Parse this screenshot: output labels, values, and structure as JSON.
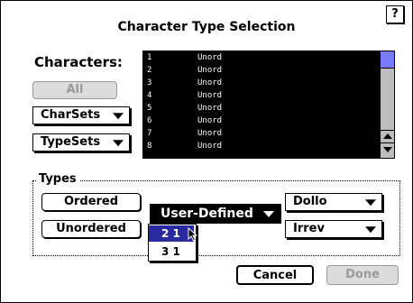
{
  "dialog": {
    "title": "Character Type Selection",
    "help_label": "?"
  },
  "characters": {
    "label": "Characters:",
    "all_button": "All",
    "charsets_popup": "CharSets",
    "typesets_popup": "TypeSets",
    "list": [
      {
        "num": "1",
        "value": "Unord"
      },
      {
        "num": "2",
        "value": "Unord"
      },
      {
        "num": "3",
        "value": "Unord"
      },
      {
        "num": "4",
        "value": "Unord"
      },
      {
        "num": "5",
        "value": "Unord"
      },
      {
        "num": "6",
        "value": "Unord"
      },
      {
        "num": "7",
        "value": "Unord"
      },
      {
        "num": "8",
        "value": "Unord"
      }
    ]
  },
  "types": {
    "label": "Types",
    "ordered_button": "Ordered",
    "unordered_button": "Unordered",
    "user_defined_popup": "User-Defined",
    "user_defined_options": [
      "2 1",
      "3 1"
    ],
    "dollo_popup": "Dollo",
    "irrev_popup": "Irrev"
  },
  "footer": {
    "cancel_button": "Cancel",
    "done_button": "Done"
  },
  "colors": {
    "list_background": "#000000",
    "scroll_thumb": "#7a7aff",
    "menu_highlight": "#2a2aa0"
  }
}
